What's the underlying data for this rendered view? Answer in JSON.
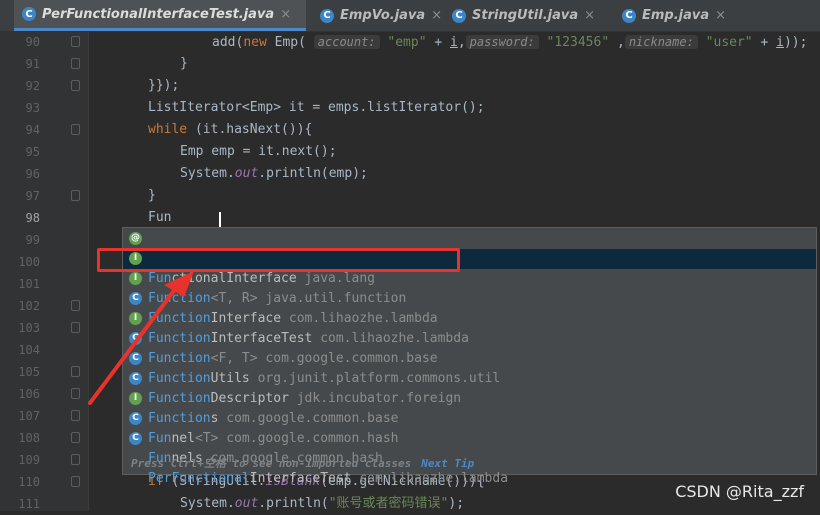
{
  "tabs": [
    {
      "label": "PerFunctionalInterfaceTest.java",
      "active": true
    },
    {
      "label": "EmpVo.java",
      "active": false
    },
    {
      "label": "StringUtil.java",
      "active": false
    },
    {
      "label": "Emp.java",
      "active": false
    }
  ],
  "tab_close": "×",
  "line_numbers": [
    "90",
    "91",
    "92",
    "93",
    "94",
    "95",
    "96",
    "97",
    "98",
    "99",
    "100",
    "101",
    "102",
    "103",
    "104",
    "105",
    "106",
    "107",
    "108",
    "109",
    "110",
    "111"
  ],
  "code": {
    "l90": {
      "pre": "add(",
      "kw1": "new",
      "mid": " Emp( ",
      "h1": "account:",
      "s1": " \"emp\"",
      "p1": " + ",
      "v1": "i",
      "c1": ",",
      "h2": "password:",
      "s2": " \"123456\"",
      "c2": " ,",
      "h3": "nickname:",
      "s3": " \"user\"",
      "p2": " + ",
      "v2": "i",
      "end": "));"
    },
    "l91": "}",
    "l92": "}});",
    "l93": "ListIterator<Emp> it = emps.listIterator();",
    "l94_kw": "while",
    "l94": " (it.hasNext()){",
    "l95": "Emp emp = it.next();",
    "l96_a": "System.",
    "l96_b": "out",
    "l96_c": ".println(emp);",
    "l97": "}",
    "l98": "Fun",
    "l110_kw": "if",
    "l110_a": " (StringUtil.",
    "l110_b": "isBlank",
    "l110_c": "(emp.getNickname())){",
    "l111_a": "System.",
    "l111_b": "out",
    "l111_c": ".println(",
    "l111_s": "\"账号或者密码错误\"",
    "l111_d": ");"
  },
  "completion": {
    "items": [
      {
        "match": "Fun",
        "rest": "ctionalInterface",
        "extra": "",
        "pkg": " java.lang",
        "icon": "@",
        "icon_color": "#62a14f"
      },
      {
        "match": "Function",
        "rest": "",
        "extra": "<T, R>",
        "pkg": " java.util.function",
        "icon": "I",
        "icon_color": "#62a14f"
      },
      {
        "match": "Function",
        "rest": "Interface",
        "extra": "",
        "pkg": " com.lihaozhe.lambda",
        "icon": "I",
        "icon_color": "#62a14f"
      },
      {
        "match": "Function",
        "rest": "InterfaceTest",
        "extra": "",
        "pkg": " com.lihaozhe.lambda",
        "icon": "C",
        "icon_color": "#3d86c6"
      },
      {
        "match": "Function",
        "rest": "",
        "extra": "<F, T>",
        "pkg": " com.google.common.base",
        "icon": "I",
        "icon_color": "#62a14f"
      },
      {
        "match": "Function",
        "rest": "Utils",
        "extra": "",
        "pkg": " org.junit.platform.commons.util",
        "icon": "C",
        "icon_color": "#3d86c6"
      },
      {
        "match": "Function",
        "rest": "Descriptor",
        "extra": "",
        "pkg": " jdk.incubator.foreign",
        "icon": "C",
        "icon_color": "#3d86c6"
      },
      {
        "match": "Function",
        "rest": "s",
        "extra": "",
        "pkg": " com.google.common.base",
        "icon": "C",
        "icon_color": "#3d86c6"
      },
      {
        "match": "Fun",
        "rest": "nel",
        "extra": "<T>",
        "pkg": " com.google.common.hash",
        "icon": "I",
        "icon_color": "#62a14f"
      },
      {
        "match": "Fun",
        "rest": "nels",
        "extra": "",
        "pkg": " com.google.common.hash",
        "icon": "C",
        "icon_color": "#3d86c6"
      },
      {
        "match": "PerFunctional",
        "rest": "InterfaceTest",
        "extra": "",
        "pkg": " com.lihaozhe.lambda",
        "icon": "C",
        "icon_color": "#3d86c6"
      }
    ],
    "footer_text": "Press Ctrl+空格 to see non-imported classes",
    "next_tip": "Next Tip"
  },
  "watermark": "CSDN @Rita_zzf",
  "colors": {
    "accent": "#4a88c7",
    "annotation": "#e8332d",
    "selection": "#0d293e"
  }
}
